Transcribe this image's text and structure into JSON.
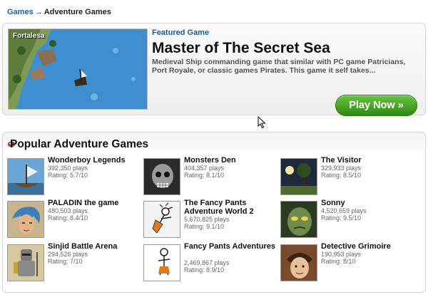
{
  "breadcrumb": {
    "home": "Games",
    "arrow": "→",
    "current": "Adventure Games"
  },
  "featured": {
    "kicker": "Featured Game",
    "thumb_label": "Fortalesa",
    "title": "Master of The Secret Sea",
    "description": "Medieval Ship commanding game that similar with PC game Patricians, Port Royale, or classic games Pirates. This game it self takes...",
    "play_label": "Play Now »"
  },
  "popular": {
    "title": "Popular Adventure Games",
    "games": [
      {
        "name": "Wonderboy Legends",
        "plays": "392,350 plays",
        "rating": "Rating: 5.7/10",
        "icon": "viking-ship-thumb"
      },
      {
        "name": "Monsters Den",
        "plays": "404,357 plays",
        "rating": "Rating: 8.1/10",
        "icon": "skull-monster-thumb"
      },
      {
        "name": "The Visitor",
        "plays": "329,933 plays",
        "rating": "Rating: 8.5/10",
        "icon": "night-tree-thumb"
      },
      {
        "name": "PALADIN the game",
        "plays": "480,503 plays",
        "rating": "Rating: 8.4/10",
        "icon": "blue-hair-warrior-thumb"
      },
      {
        "name": "The Fancy Pants Adventure World 2",
        "plays": "5,670,825 plays",
        "rating": "Rating: 9.1/10",
        "icon": "stick-figure-thumb"
      },
      {
        "name": "Sonny",
        "plays": "4,520,659 plays",
        "rating": "Rating: 9.5/10",
        "icon": "zombie-face-thumb"
      },
      {
        "name": "Sinjid Battle Arena",
        "plays": "294,526 plays",
        "rating": "Rating: 7/10",
        "icon": "armored-knight-thumb"
      },
      {
        "name": "Fancy Pants Adventures",
        "plays": "2,469,867 plays",
        "rating": "Rating: 8.9/10",
        "icon": "stick-figure-thumb"
      },
      {
        "name": "Detective Grimoire",
        "plays": "190,953 plays",
        "rating": "Rating: 8/10",
        "icon": "detective-face-thumb"
      }
    ]
  }
}
